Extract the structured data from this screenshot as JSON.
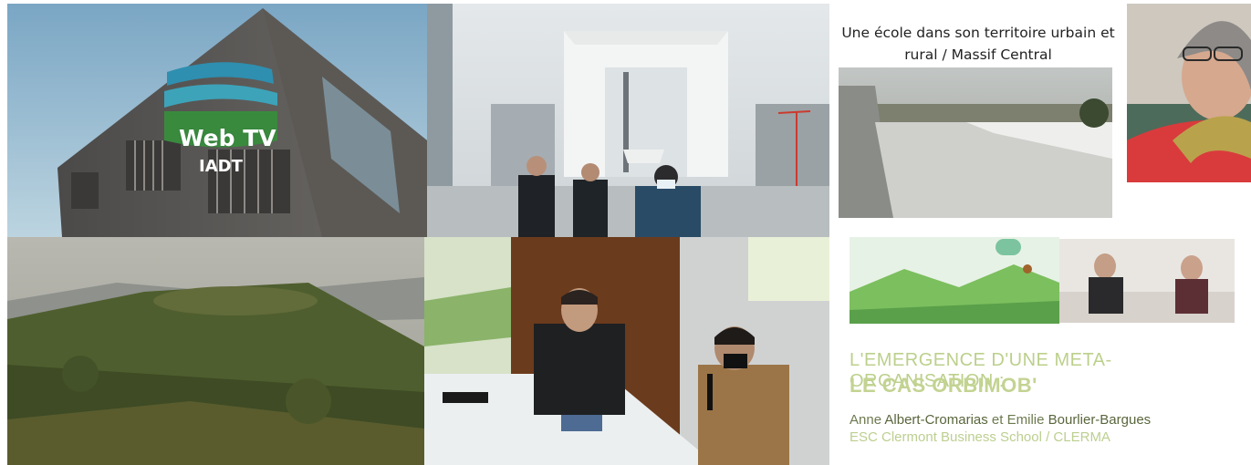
{
  "tile_building": {
    "logo_line1": "Web TV",
    "logo_line2": "IADT"
  },
  "tile_slide_top": {
    "title": "Une école dans son territoire urbain et rural / Massif Central"
  },
  "tile_slide_bottom": {
    "title_line1": "L'EMERGENCE D'UNE META-ORGANISATION :",
    "title_line2": "LE CAS ORBIMOB'",
    "authors_prefix": "Anne",
    "author1": "Albert-Cromarias",
    "authors_and": "et",
    "authors_emilie": "Emilie",
    "author2": "Bourlier-Bargues",
    "school": "ESC Clermont Business School / CLERMA"
  },
  "colors": {
    "slide_green_light": "#c3d392",
    "slide_green_dark": "#59663c",
    "logo_green": "#3a8a3e",
    "logo_blue": "#2e8fb0"
  }
}
